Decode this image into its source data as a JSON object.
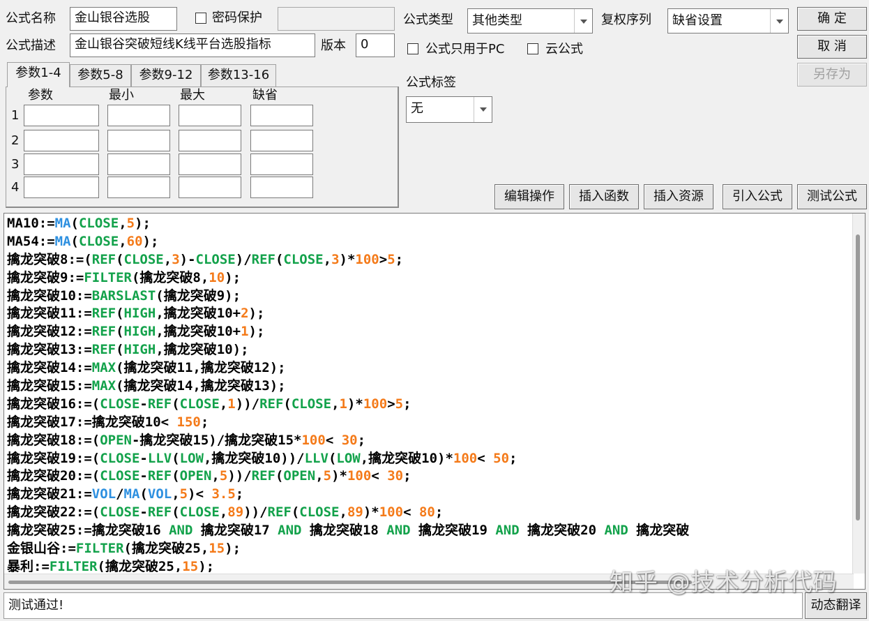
{
  "colors": {
    "keyword": "#13a24b",
    "function": "#2e90e0",
    "number": "#f47a19",
    "identifier": "#000000"
  },
  "header": {
    "name_label": "公式名称",
    "name_value": "金山银谷选股",
    "password_label": "密码保护",
    "desc_label": "公式描述",
    "desc_value": "金山银谷突破短线K线平台选股指标",
    "version_label": "版本",
    "version_value": "0",
    "type_label": "公式类型",
    "type_value": "其他类型",
    "rights_label": "复权序列",
    "rights_value": "缺省设置",
    "pc_only_label": "公式只用于PC",
    "cloud_label": "云公式",
    "tag_label": "公式标签",
    "tag_value": "无"
  },
  "buttons": {
    "ok": "确  定",
    "cancel": "取  消",
    "save_as": "另存为",
    "edit_ops": "编辑操作",
    "insert_func": "插入函数",
    "insert_res": "插入资源",
    "import_formula": "引入公式",
    "test_formula": "测试公式",
    "dynamic_translate": "动态翻译"
  },
  "tabs": [
    "参数1-4",
    "参数5-8",
    "参数9-12",
    "参数13-16"
  ],
  "params": {
    "headers": [
      "参数",
      "最小",
      "最大",
      "缺省"
    ],
    "rows": [
      "1",
      "2",
      "3",
      "4"
    ]
  },
  "code_lines": [
    [
      [
        "MA10:=",
        "i"
      ],
      [
        "MA",
        "f"
      ],
      [
        "(",
        "i"
      ],
      [
        "CLOSE",
        "k"
      ],
      [
        ",",
        "i"
      ],
      [
        "5",
        "n"
      ],
      [
        ");",
        "i"
      ]
    ],
    [
      [
        "MA54:=",
        "i"
      ],
      [
        "MA",
        "f"
      ],
      [
        "(",
        "i"
      ],
      [
        "CLOSE",
        "k"
      ],
      [
        ",",
        "i"
      ],
      [
        "60",
        "n"
      ],
      [
        ");",
        "i"
      ]
    ],
    [
      [
        "擒龙突破8:=(",
        "i"
      ],
      [
        "REF",
        "k"
      ],
      [
        "(",
        "i"
      ],
      [
        "CLOSE",
        "k"
      ],
      [
        ",",
        "i"
      ],
      [
        "3",
        "n"
      ],
      [
        ")-",
        "i"
      ],
      [
        "CLOSE",
        "k"
      ],
      [
        ")/",
        "i"
      ],
      [
        "REF",
        "k"
      ],
      [
        "(",
        "i"
      ],
      [
        "CLOSE",
        "k"
      ],
      [
        ",",
        "i"
      ],
      [
        "3",
        "n"
      ],
      [
        ")*",
        "i"
      ],
      [
        "100",
        "n"
      ],
      [
        ">",
        "i"
      ],
      [
        "5",
        "n"
      ],
      [
        ";",
        "i"
      ]
    ],
    [
      [
        "擒龙突破9:=",
        "i"
      ],
      [
        "FILTER",
        "k"
      ],
      [
        "(擒龙突破8,",
        "i"
      ],
      [
        "10",
        "n"
      ],
      [
        ");",
        "i"
      ]
    ],
    [
      [
        "擒龙突破10:=",
        "i"
      ],
      [
        "BARSLAST",
        "k"
      ],
      [
        "(擒龙突破9);",
        "i"
      ]
    ],
    [
      [
        "擒龙突破11:=",
        "i"
      ],
      [
        "REF",
        "k"
      ],
      [
        "(",
        "i"
      ],
      [
        "HIGH",
        "k"
      ],
      [
        ",擒龙突破10+",
        "i"
      ],
      [
        "2",
        "n"
      ],
      [
        ");",
        "i"
      ]
    ],
    [
      [
        "擒龙突破12:=",
        "i"
      ],
      [
        "REF",
        "k"
      ],
      [
        "(",
        "i"
      ],
      [
        "HIGH",
        "k"
      ],
      [
        ",擒龙突破10+",
        "i"
      ],
      [
        "1",
        "n"
      ],
      [
        ");",
        "i"
      ]
    ],
    [
      [
        "擒龙突破13:=",
        "i"
      ],
      [
        "REF",
        "k"
      ],
      [
        "(",
        "i"
      ],
      [
        "HIGH",
        "k"
      ],
      [
        ",擒龙突破10);",
        "i"
      ]
    ],
    [
      [
        "擒龙突破14:=",
        "i"
      ],
      [
        "MAX",
        "k"
      ],
      [
        "(擒龙突破11,擒龙突破12);",
        "i"
      ]
    ],
    [
      [
        "擒龙突破15:=",
        "i"
      ],
      [
        "MAX",
        "k"
      ],
      [
        "(擒龙突破14,擒龙突破13);",
        "i"
      ]
    ],
    [
      [
        "擒龙突破16:=(",
        "i"
      ],
      [
        "CLOSE",
        "k"
      ],
      [
        "-",
        "i"
      ],
      [
        "REF",
        "k"
      ],
      [
        "(",
        "i"
      ],
      [
        "CLOSE",
        "k"
      ],
      [
        ",",
        "i"
      ],
      [
        "1",
        "n"
      ],
      [
        "))/",
        "i"
      ],
      [
        "REF",
        "k"
      ],
      [
        "(",
        "i"
      ],
      [
        "CLOSE",
        "k"
      ],
      [
        ",",
        "i"
      ],
      [
        "1",
        "n"
      ],
      [
        ")*",
        "i"
      ],
      [
        "100",
        "n"
      ],
      [
        ">",
        "i"
      ],
      [
        "5",
        "n"
      ],
      [
        ";",
        "i"
      ]
    ],
    [
      [
        "擒龙突破17:=擒龙突破10< ",
        "i"
      ],
      [
        "150",
        "n"
      ],
      [
        ";",
        "i"
      ]
    ],
    [
      [
        "擒龙突破18:=(",
        "i"
      ],
      [
        "OPEN",
        "k"
      ],
      [
        "-擒龙突破15)/擒龙突破15*",
        "i"
      ],
      [
        "100",
        "n"
      ],
      [
        "< ",
        "i"
      ],
      [
        "30",
        "n"
      ],
      [
        ";",
        "i"
      ]
    ],
    [
      [
        "擒龙突破19:=(",
        "i"
      ],
      [
        "CLOSE",
        "k"
      ],
      [
        "-",
        "i"
      ],
      [
        "LLV",
        "k"
      ],
      [
        "(",
        "i"
      ],
      [
        "LOW",
        "k"
      ],
      [
        ",擒龙突破10))/",
        "i"
      ],
      [
        "LLV",
        "k"
      ],
      [
        "(",
        "i"
      ],
      [
        "LOW",
        "k"
      ],
      [
        ",擒龙突破10)*",
        "i"
      ],
      [
        "100",
        "n"
      ],
      [
        "< ",
        "i"
      ],
      [
        "50",
        "n"
      ],
      [
        ";",
        "i"
      ]
    ],
    [
      [
        "擒龙突破20:=(",
        "i"
      ],
      [
        "CLOSE",
        "k"
      ],
      [
        "-",
        "i"
      ],
      [
        "REF",
        "k"
      ],
      [
        "(",
        "i"
      ],
      [
        "OPEN",
        "k"
      ],
      [
        ",",
        "i"
      ],
      [
        "5",
        "n"
      ],
      [
        "))/",
        "i"
      ],
      [
        "REF",
        "k"
      ],
      [
        "(",
        "i"
      ],
      [
        "OPEN",
        "k"
      ],
      [
        ",",
        "i"
      ],
      [
        "5",
        "n"
      ],
      [
        ")*",
        "i"
      ],
      [
        "100",
        "n"
      ],
      [
        "< ",
        "i"
      ],
      [
        "30",
        "n"
      ],
      [
        ";",
        "i"
      ]
    ],
    [
      [
        "擒龙突破21:=",
        "i"
      ],
      [
        "VOL",
        "f"
      ],
      [
        "/",
        "i"
      ],
      [
        "MA",
        "f"
      ],
      [
        "(",
        "i"
      ],
      [
        "VOL",
        "f"
      ],
      [
        ",",
        "i"
      ],
      [
        "5",
        "n"
      ],
      [
        ")< ",
        "i"
      ],
      [
        "3.5",
        "n"
      ],
      [
        ";",
        "i"
      ]
    ],
    [
      [
        "擒龙突破22:=(",
        "i"
      ],
      [
        "CLOSE",
        "k"
      ],
      [
        "-",
        "i"
      ],
      [
        "REF",
        "k"
      ],
      [
        "(",
        "i"
      ],
      [
        "CLOSE",
        "k"
      ],
      [
        ",",
        "i"
      ],
      [
        "89",
        "n"
      ],
      [
        "))/",
        "i"
      ],
      [
        "REF",
        "k"
      ],
      [
        "(",
        "i"
      ],
      [
        "CLOSE",
        "k"
      ],
      [
        ",",
        "i"
      ],
      [
        "89",
        "n"
      ],
      [
        ")*",
        "i"
      ],
      [
        "100",
        "n"
      ],
      [
        "< ",
        "i"
      ],
      [
        "80",
        "n"
      ],
      [
        ";",
        "i"
      ]
    ],
    [
      [
        "擒龙突破25:=擒龙突破16 ",
        "i"
      ],
      [
        "AND",
        "k"
      ],
      [
        " 擒龙突破17 ",
        "i"
      ],
      [
        "AND",
        "k"
      ],
      [
        " 擒龙突破18 ",
        "i"
      ],
      [
        "AND",
        "k"
      ],
      [
        " 擒龙突破19 ",
        "i"
      ],
      [
        "AND",
        "k"
      ],
      [
        " 擒龙突破20 ",
        "i"
      ],
      [
        "AND",
        "k"
      ],
      [
        " 擒龙突破",
        "i"
      ]
    ],
    [
      [
        "金银山谷:=",
        "i"
      ],
      [
        "FILTER",
        "k"
      ],
      [
        "(擒龙突破25,",
        "i"
      ],
      [
        "15",
        "n"
      ],
      [
        ");",
        "i"
      ]
    ],
    [
      [
        "暴利:=",
        "i"
      ],
      [
        "FILTER",
        "k"
      ],
      [
        "(擒龙突破25,",
        "i"
      ],
      [
        "15",
        "n"
      ],
      [
        ");",
        "i"
      ]
    ]
  ],
  "status_text": "测试通过!",
  "watermark": "知乎 @技术分析代码"
}
